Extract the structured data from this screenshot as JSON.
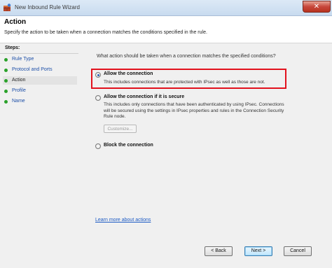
{
  "window": {
    "title": "New Inbound Rule Wizard",
    "close_label": "✕"
  },
  "header": {
    "title": "Action",
    "subtitle": "Specify the action to be taken when a connection matches the conditions specified in the rule."
  },
  "steps": {
    "title": "Steps:",
    "items": [
      {
        "label": "Rule Type"
      },
      {
        "label": "Protocol and Ports"
      },
      {
        "label": "Action"
      },
      {
        "label": "Profile"
      },
      {
        "label": "Name"
      }
    ],
    "current_index": 2
  },
  "content": {
    "question": "What action should be taken when a connection matches the specified conditions?",
    "options": [
      {
        "label": "Allow the connection",
        "description": "This includes connections that are protected with IPsec as well as those are not.",
        "selected": true
      },
      {
        "label": "Allow the connection if it is secure",
        "description": "This includes only connections that have been authenticated by using IPsec. Connections will be secured using the settings in IPsec properties and rules in the Connection Security Rule node.",
        "selected": false
      },
      {
        "label": "Block the connection",
        "description": "",
        "selected": false
      }
    ],
    "customize_label": "Customize...",
    "learn_more": "Learn more about actions"
  },
  "buttons": {
    "back": "< Back",
    "next": "Next >",
    "cancel": "Cancel"
  },
  "colors": {
    "highlight_border": "#e2111d",
    "step_dot": "#2aa12a",
    "link": "#1c5ac4"
  }
}
